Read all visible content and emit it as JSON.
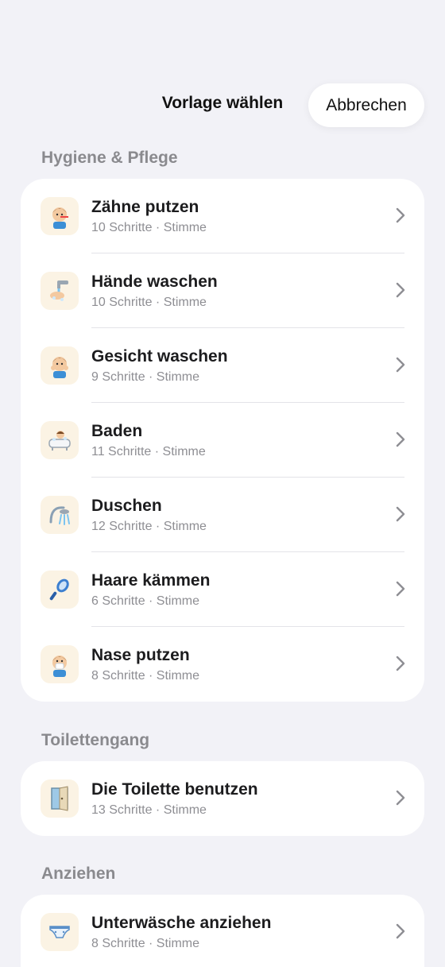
{
  "header": {
    "title": "Vorlage wählen",
    "cancel_label": "Abbrechen"
  },
  "sections": [
    {
      "title": "Hygiene & Pflege",
      "items": [
        {
          "title": "Zähne putzen",
          "subtitle": "10 Schritte · Stimme",
          "icon": "child-brushing-teeth-icon"
        },
        {
          "title": "Hände waschen",
          "subtitle": "10 Schritte · Stimme",
          "icon": "faucet-hands-icon"
        },
        {
          "title": "Gesicht waschen",
          "subtitle": "9 Schritte · Stimme",
          "icon": "child-washing-face-icon"
        },
        {
          "title": "Baden",
          "subtitle": "11 Schritte · Stimme",
          "icon": "bathtub-icon"
        },
        {
          "title": "Duschen",
          "subtitle": "12 Schritte · Stimme",
          "icon": "shower-head-icon"
        },
        {
          "title": "Haare kämmen",
          "subtitle": "6 Schritte · Stimme",
          "icon": "hairbrush-icon"
        },
        {
          "title": "Nase putzen",
          "subtitle": "8 Schritte · Stimme",
          "icon": "child-blowing-nose-icon"
        }
      ]
    },
    {
      "title": "Toilettengang",
      "items": [
        {
          "title": "Die Toilette benutzen",
          "subtitle": "13 Schritte · Stimme",
          "icon": "toilet-door-icon"
        }
      ]
    },
    {
      "title": "Anziehen",
      "items": [
        {
          "title": "Unterwäsche anziehen",
          "subtitle": "8 Schritte · Stimme",
          "icon": "underwear-icon"
        }
      ]
    }
  ]
}
